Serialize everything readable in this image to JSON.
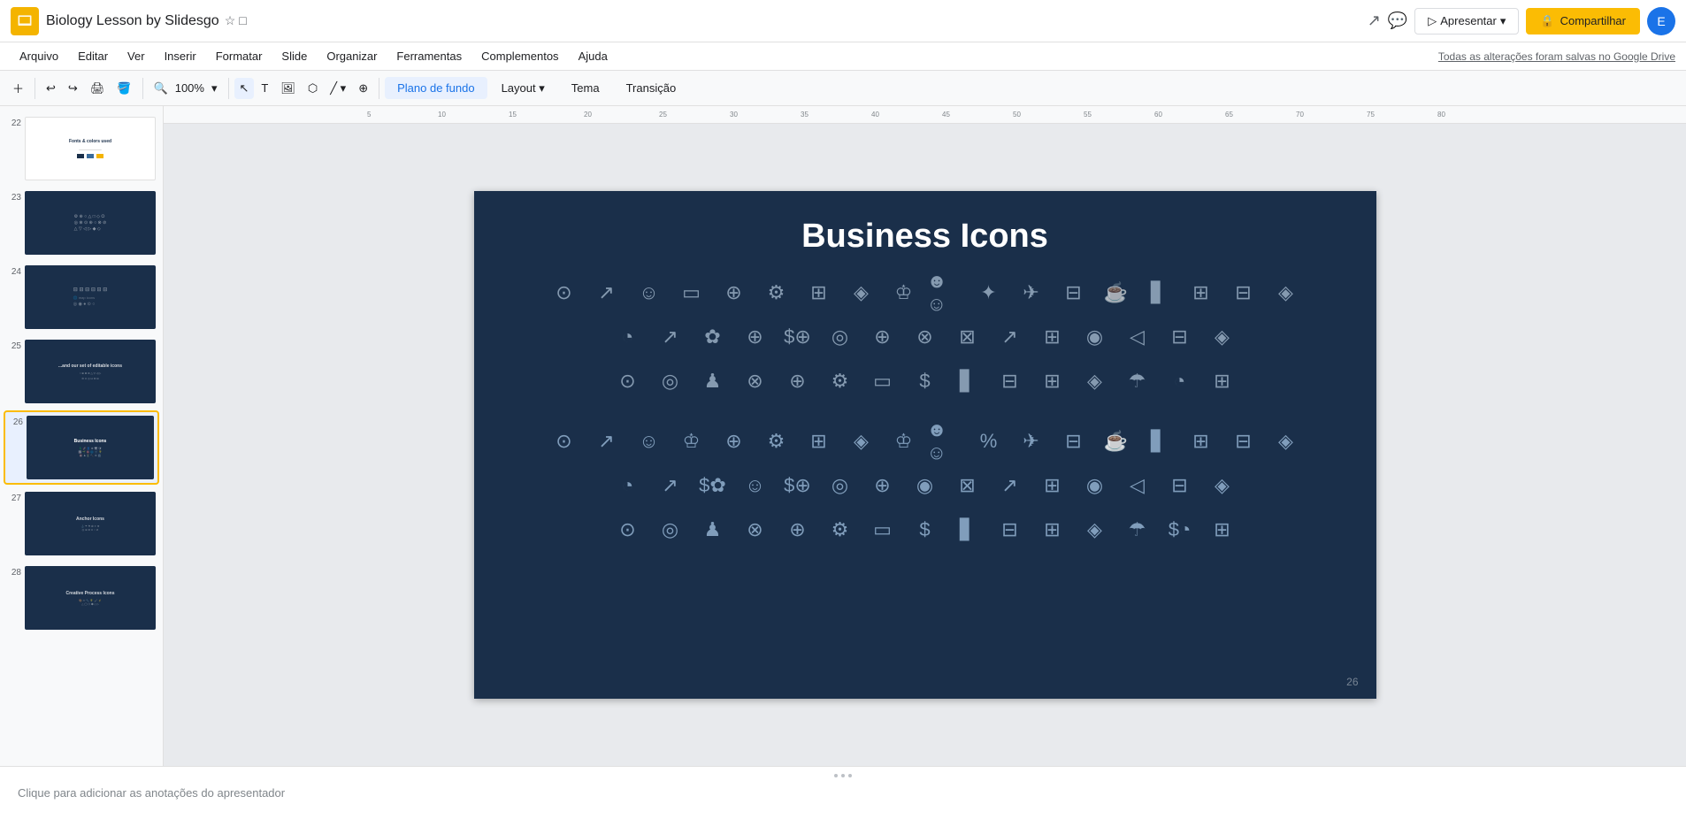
{
  "app": {
    "icon_color": "#f4b400",
    "title": "Biology Lesson by Slidesgo",
    "save_status": "Todas as alterações foram salvas no Google Drive"
  },
  "menu": {
    "items": [
      "Arquivo",
      "Editar",
      "Ver",
      "Inserir",
      "Formatar",
      "Slide",
      "Organizar",
      "Ferramentas",
      "Complementos",
      "Ajuda"
    ]
  },
  "toolbar": {
    "zoom_level": "100%",
    "plano_fundo": "Plano de fundo",
    "layout": "Layout",
    "tema": "Tema",
    "transicao": "Transição"
  },
  "slide": {
    "title": "Business Icons",
    "page_number": "26",
    "background_color": "#1a2f4a"
  },
  "sidebar": {
    "slides": [
      {
        "num": "22",
        "type": "light",
        "has_text": true
      },
      {
        "num": "23",
        "type": "dark",
        "has_icons": true
      },
      {
        "num": "24",
        "type": "dark",
        "has_map": true
      },
      {
        "num": "25",
        "type": "dark",
        "has_text": true
      },
      {
        "num": "26",
        "type": "dark",
        "active": true,
        "has_icons": true
      },
      {
        "num": "27",
        "type": "dark",
        "has_icons2": true
      },
      {
        "num": "28",
        "type": "dark",
        "has_process": true
      }
    ]
  },
  "icons_row1": [
    "💲",
    "🚀",
    "👤",
    "🖥️",
    "🔍",
    "⚙️",
    "💻",
    "🛡️",
    "🏆",
    "👥",
    "⭐",
    "✈️",
    "📋",
    "☕",
    "📊",
    "🏭",
    "🏢",
    "🔗"
  ],
  "icons_row2": [
    "📈",
    "📊",
    "🌱",
    "👔",
    "🏷️",
    "🎯",
    "🌐",
    "🔍",
    "🛒",
    "📉",
    "📑",
    "💡",
    "📢",
    "🪪",
    "🔗"
  ],
  "icons_row3": [
    "⏰",
    "🧠",
    "♟️",
    "⏳",
    "🔨",
    "⚙️",
    "🖥️",
    "💰",
    "📊",
    "🗂️",
    "🏦",
    "💵",
    "☂️",
    "📊",
    "📊"
  ],
  "icons_row4": [
    "💲",
    "🚀",
    "👤",
    "🏆",
    "🔍",
    "⚙️",
    "💻",
    "🛡️",
    "🏆",
    "👥",
    "💯",
    "✈️",
    "📋",
    "☕",
    "📊",
    "🏭",
    "🏢",
    "🔗"
  ],
  "icons_row5": [
    "📈",
    "📊",
    "💲",
    "👔",
    "🏷️",
    "🎯",
    "🌐",
    "📍",
    "🛒",
    "📉",
    "📑",
    "💡",
    "📢",
    "🪪",
    "🔗"
  ],
  "icons_row6": [
    "⏰",
    "🌀",
    "♟️",
    "⏳",
    "🔨",
    "⚙️",
    "🖥️",
    "💰",
    "📊",
    "🗂️",
    "🏦",
    "💵",
    "☂️",
    "💲",
    "📊"
  ],
  "notes": {
    "placeholder": "Clique para adicionar as anotações do apresentador"
  },
  "buttons": {
    "apresentar": "Apresentar",
    "compartilhar": "Compartilhar",
    "user_initial": "E"
  }
}
